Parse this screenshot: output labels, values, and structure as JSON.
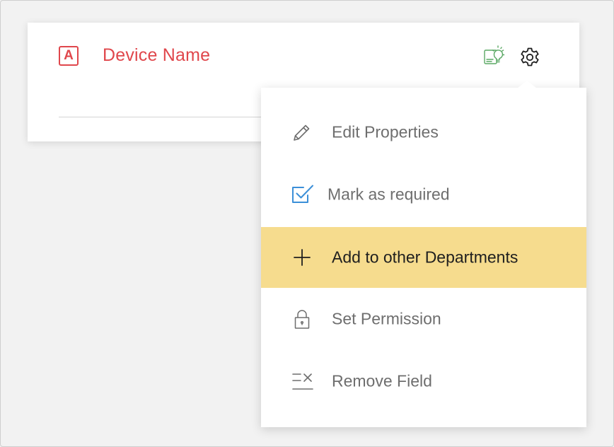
{
  "field": {
    "type_badge": "A",
    "label": "Device Name"
  },
  "icons": {
    "field_type": "text-field-icon",
    "hint": "lightbulb-hint-icon",
    "settings": "gear-icon"
  },
  "menu": {
    "items": [
      {
        "label": "Edit Properties",
        "icon": "pencil-icon",
        "active": false
      },
      {
        "label": "Mark as required",
        "icon": "checkbox-checked-icon",
        "active": false
      },
      {
        "label": "Add to other Departments",
        "icon": "plus-icon",
        "active": true
      },
      {
        "label": "Set Permission",
        "icon": "lock-icon",
        "active": false
      },
      {
        "label": "Remove Field",
        "icon": "remove-field-icon",
        "active": false
      }
    ]
  },
  "colors": {
    "accent_red": "#e0474c",
    "highlight": "#f6dc8e",
    "hint_green": "#5aa864",
    "checkbox_blue": "#3b8fd8"
  }
}
